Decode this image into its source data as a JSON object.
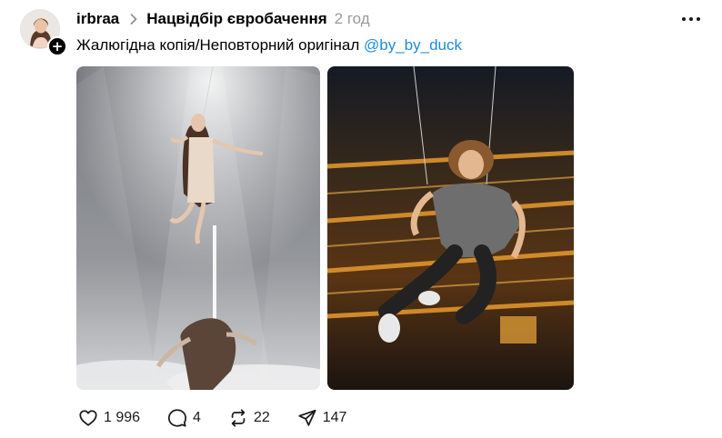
{
  "post": {
    "author": "irbraa",
    "community": "Нацвідбір євробачення",
    "time": "2 год",
    "caption_text": "Жалюгідна копія/Неповторний оригінал ",
    "mention": "@by_by_duck",
    "follow_symbol": "+"
  },
  "images": [
    {
      "icon": "photo-singer-suspended-stage"
    },
    {
      "icon": "photo-curly-man-suspended-orange-stage"
    }
  ],
  "actions": {
    "likes": "1 996",
    "comments": "4",
    "reposts": "22",
    "shares": "147"
  },
  "icons": {
    "like": "heart-icon",
    "comment": "speech-bubble-icon",
    "repost": "repost-arrows-icon",
    "share": "paper-plane-icon",
    "more": "ellipsis-icon"
  },
  "colors": {
    "mention": "#1d8cd8",
    "time": "#9a9a9a",
    "text": "#000000"
  }
}
